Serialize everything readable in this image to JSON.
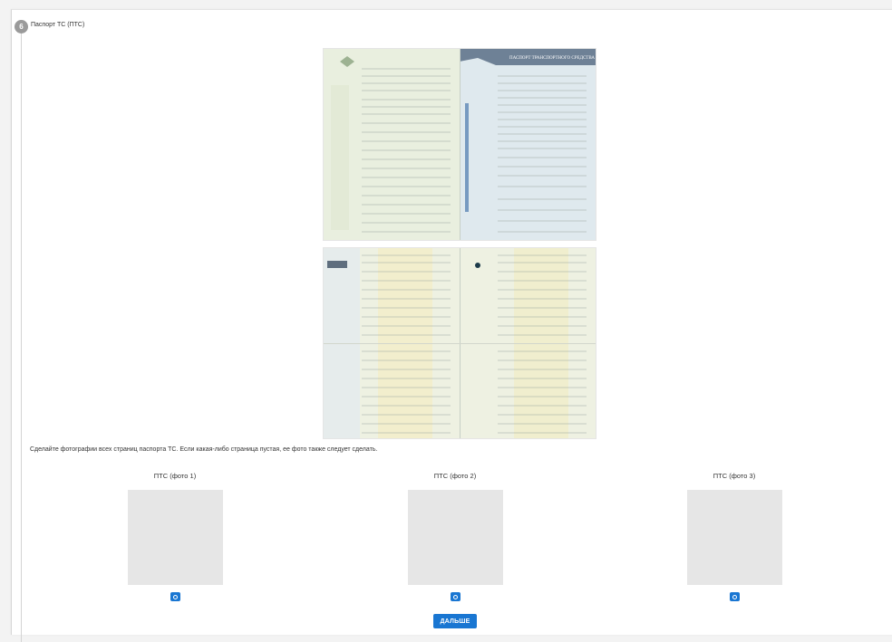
{
  "step": {
    "number": "6",
    "title": "Паспорт ТС (ПТС)"
  },
  "instruction": "Сделайте фотографии всех страниц паспорта ТС. Если какая-либо страница пустая, ее фото также следует сделать.",
  "sample_document": {
    "heading": "ПАСПОРТ ТРАНСПОРТНОГО СРЕДСТВА"
  },
  "photos": [
    {
      "label": "ПТС (фото 1)",
      "icon": "camera-icon"
    },
    {
      "label": "ПТС (фото 2)",
      "icon": "camera-icon"
    },
    {
      "label": "ПТС (фото 3)",
      "icon": "camera-icon"
    }
  ],
  "actions": {
    "next_label": "ДАЛЬШЕ"
  },
  "colors": {
    "accent": "#1976d2",
    "photo_placeholder": "#e6e6e6",
    "step_badge": "#9a9a9a"
  }
}
